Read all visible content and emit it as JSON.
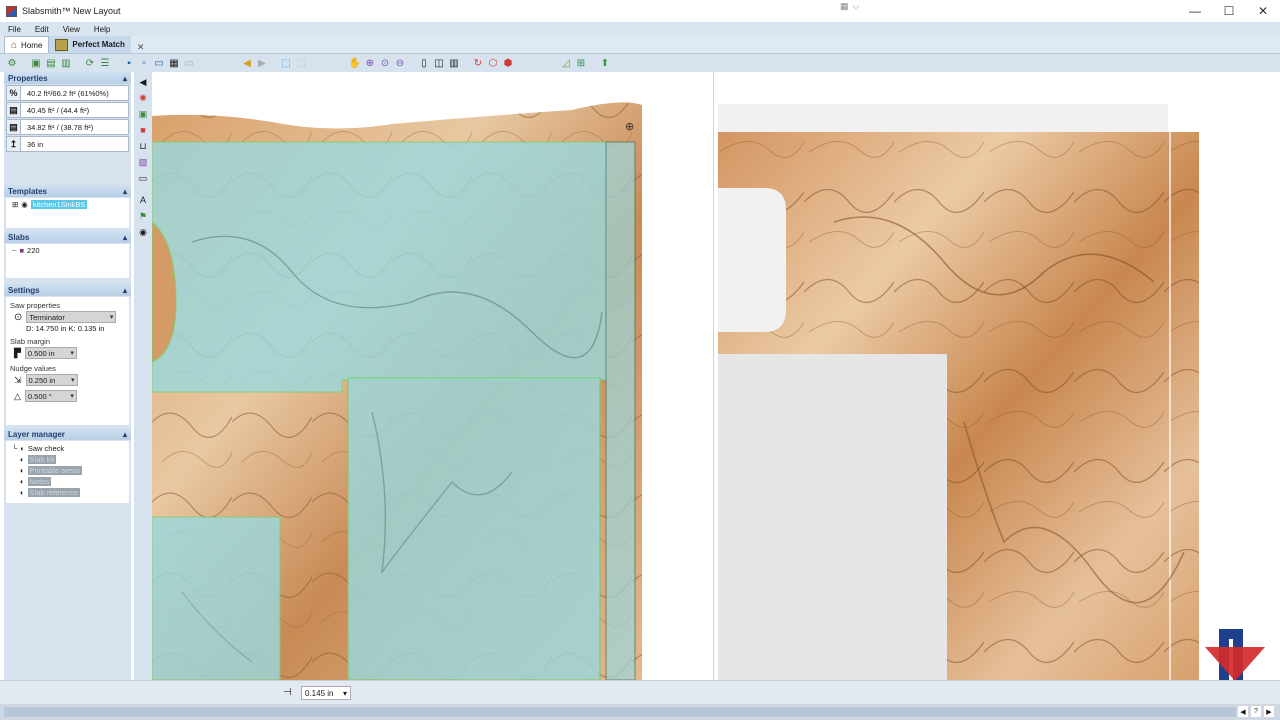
{
  "window": {
    "title": "Slabsmith™ New Layout"
  },
  "menu": [
    "File",
    "Edit",
    "View",
    "Help"
  ],
  "tabs": {
    "home": "Home",
    "perfect_match": "Perfect Match",
    "close": "✕"
  },
  "properties": {
    "header": "Properties",
    "rows": [
      "40.2 ft²/66.2 ft² (61%0%)",
      "40.45 ft² / (44.4 ft²)",
      "34.82 ft² / (38.78 ft²)",
      "36 in"
    ]
  },
  "templates": {
    "header": "Templates",
    "item": "kitchen1SinkBS"
  },
  "slabs": {
    "header": "Slabs",
    "item": "220"
  },
  "settings": {
    "header": "Settings",
    "saw_properties_label": "Saw properties",
    "saw": "Terminator",
    "saw_dims": "D: 14.750 in   K: 0.135 in",
    "slab_margin_label": "Slab margin",
    "slab_margin": "0.500 in",
    "nudge_label": "Nudge values",
    "nudge_dist": "0.250 in",
    "nudge_angle": "0.500 °"
  },
  "layer_manager": {
    "header": "Layer manager",
    "items": [
      "Saw check",
      "Slab kit",
      "Printable areas",
      "Notes",
      "Slab reference"
    ]
  },
  "status": {
    "value": "0.145 in"
  },
  "colors": {
    "accent": "#2b5fb3",
    "panel_bg": "#d6e2ee",
    "teal_overlay": "#9cd8dd",
    "stone": "#d9a36e"
  }
}
